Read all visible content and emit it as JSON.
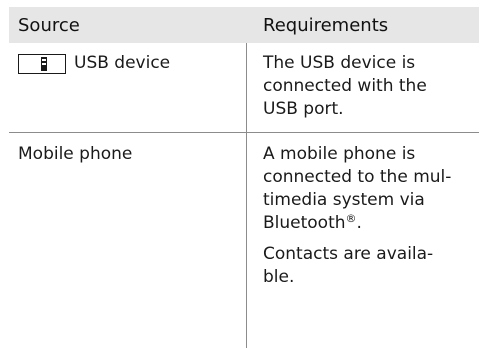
{
  "header": {
    "source": "Source",
    "requirements": "Requirements"
  },
  "rows": [
    {
      "source": "USB device",
      "source_icon": "usb-stick-icon",
      "requirements_lines": [
        "The USB device is",
        "connected with the",
        "USB port."
      ]
    },
    {
      "source": "Mobile phone",
      "requirements_lines": [
        "A mobile phone is",
        "connected to the mul-",
        "timedia system via"
      ],
      "bluetooth": "Bluetooth",
      "registered": "®",
      "period": ".",
      "contacts_lines": [
        "Contacts are availa-",
        "ble."
      ]
    }
  ]
}
